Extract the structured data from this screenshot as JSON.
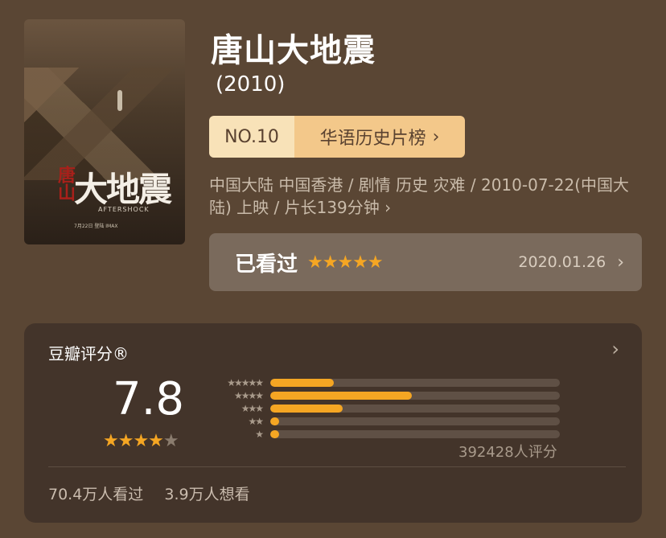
{
  "poster": {
    "title_text": "大地震",
    "red_text": "唐山",
    "english_text": "AFTERSHOCK",
    "release_note": "7月22日 登陆 IMAX"
  },
  "movie": {
    "title": "唐山大地震",
    "year": "(2010)"
  },
  "rank": {
    "number": "NO.10",
    "list_name": "华语历史片榜",
    "chevron": "›"
  },
  "meta": {
    "text": "中国大陆 中国香港 / 剧情 历史 灾难 / 2010-07-22(中国大陆) 上映 / 片长139分钟",
    "chevron": "›"
  },
  "watched": {
    "label": "已看过",
    "stars": "★★★★★",
    "date": "2020.01.26",
    "chevron": "›",
    "user_rating": 5
  },
  "rating": {
    "title": "豆瓣评分®",
    "chevron": "›",
    "score": "7.8",
    "stars_on": "★★★★",
    "stars_off": "★",
    "star_level": 4,
    "count_text": "392428人评分",
    "distribution": [
      {
        "stars": "★★★★★",
        "fraction": 0.22
      },
      {
        "stars": "★★★★",
        "fraction": 0.49
      },
      {
        "stars": "★★★",
        "fraction": 0.25
      },
      {
        "stars": "★★",
        "fraction": 0.03
      },
      {
        "stars": "★",
        "fraction": 0.03
      }
    ]
  },
  "footer": {
    "watched_count": "70.4万人看过",
    "want_count": "3.9万人想看"
  },
  "colors": {
    "background": "#5a4634",
    "accent": "#f5a623",
    "rank_light": "#f8e2b8",
    "rank_dark": "#f3c88a"
  }
}
